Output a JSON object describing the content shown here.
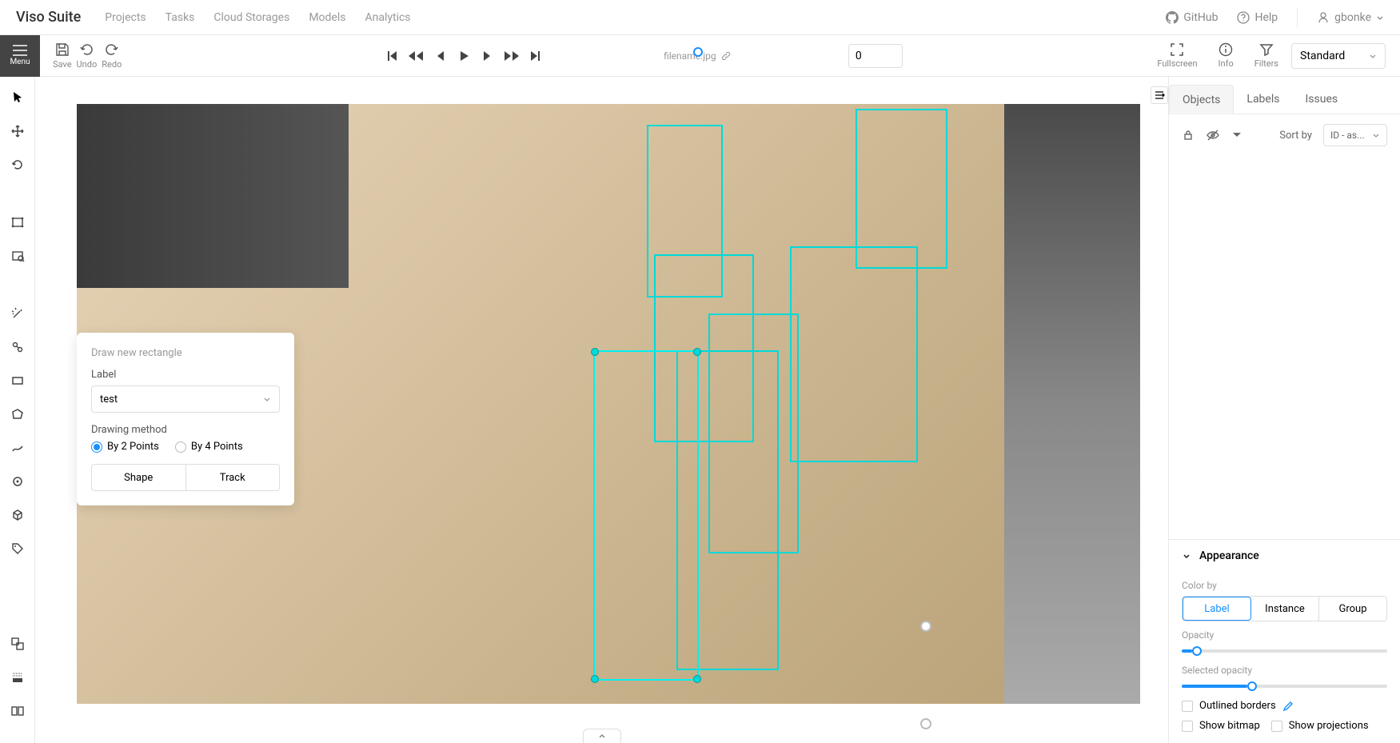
{
  "brand": "Viso Suite",
  "nav": {
    "links": [
      "Projects",
      "Tasks",
      "Cloud Storages",
      "Models",
      "Analytics"
    ],
    "github": "GitHub",
    "help": "Help",
    "user": "gbonke"
  },
  "toolbar": {
    "menu": "Menu",
    "save": "Save",
    "undo": "Undo",
    "redo": "Redo",
    "filename": "filename.jpg",
    "frame_value": "0",
    "fullscreen": "Fullscreen",
    "info": "Info",
    "filters": "Filters",
    "workspace": "Standard"
  },
  "popup": {
    "title": "Draw new rectangle",
    "label_title": "Label",
    "label_value": "test",
    "method_title": "Drawing method",
    "radio1": "By 2 Points",
    "radio2": "By 4 Points",
    "shape": "Shape",
    "track": "Track"
  },
  "panel": {
    "tab_objects": "Objects",
    "tab_labels": "Labels",
    "tab_issues": "Issues",
    "sort_by": "Sort by",
    "sort_value": "ID - as..."
  },
  "appearance": {
    "title": "Appearance",
    "color_by": "Color by",
    "seg_label": "Label",
    "seg_instance": "Instance",
    "seg_group": "Group",
    "opacity": "Opacity",
    "selected_opacity": "Selected opacity",
    "outlined": "Outlined borders",
    "show_bitmap": "Show bitmap",
    "show_projections": "Show projections"
  }
}
